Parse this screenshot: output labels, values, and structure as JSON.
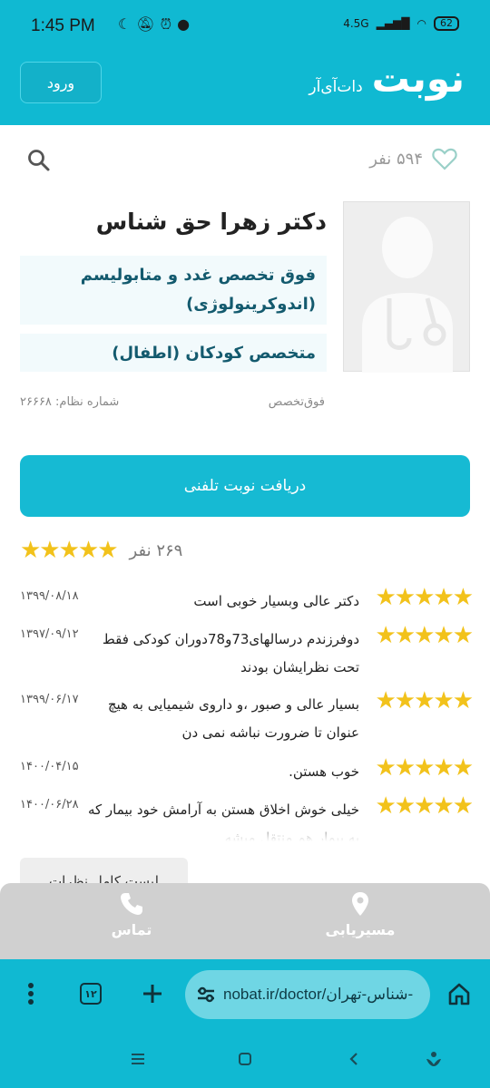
{
  "status_bar": {
    "time": "1:45 PM",
    "network": "4.5G",
    "battery": "62"
  },
  "app_bar": {
    "logo_main": "نوبت",
    "logo_sub": "دات‌آی‌آر",
    "login_label": "ورود"
  },
  "profile": {
    "likes": "۵۹۴ نفر",
    "name": "دکتر زهرا حق شناس",
    "specialties": [
      "فوق تخصص غدد و متابولیسم (اندوکرینولوژی)",
      "متخصص کودکان (اطفال)"
    ],
    "specialty_level": "فوق‌تخصص",
    "registration": "شماره نظام: ۲۶۶۶۸",
    "call_button": "دریافت نوبت تلفنی",
    "rating_count": "۲۶۹ نفر",
    "rating": 5
  },
  "reviews": [
    {
      "text": "دکتر عالی وبسیار خوبی است",
      "date": "۱۳۹۹/۰۸/۱۸",
      "stars": 5
    },
    {
      "text": "دوفرزندم درسالهای73و78دوران کودکی فقط تحت نظرایشان بودند",
      "date": "۱۳۹۷/۰۹/۱۲",
      "stars": 5
    },
    {
      "text": "بسیار عالی و صبور ،و داروی شیمیایی به هیچ عنوان تا ضرورت نباشه نمی دن",
      "date": "۱۳۹۹/۰۶/۱۷",
      "stars": 5
    },
    {
      "text": "خوب هستن.",
      "date": "۱۴۰۰/۰۴/۱۵",
      "stars": 5
    },
    {
      "text": "خیلی خوش اخلاق هستن به آرامش خود بیمار که به بیمار هم منتقل میشه",
      "date": "۱۴۰۰/۰۶/۲۸",
      "stars": 5
    }
  ],
  "all_reviews_label": "لیست کامل نظرات",
  "bottom_nav": {
    "contact": "تماس",
    "route": "مسیریابی"
  },
  "browser": {
    "url": "nobat.ir/doctor/شناس-تهران-",
    "tabs_count": "۱۲"
  },
  "colors": {
    "brand": "#10b9d2",
    "star": "#f2c21b",
    "specialty_text": "#135a6e"
  }
}
